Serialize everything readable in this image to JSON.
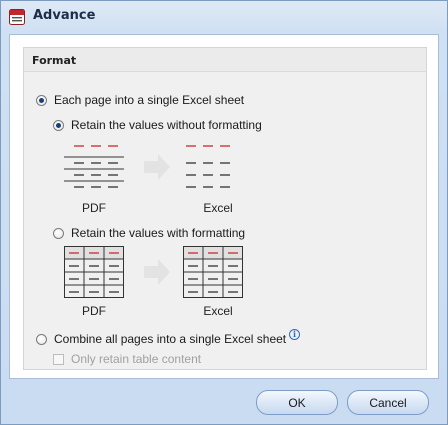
{
  "window": {
    "title": "Advance"
  },
  "format": {
    "heading": "Format",
    "option_each_page": {
      "label": "Each page into a single Excel sheet",
      "checked": true
    },
    "option_retain_values": {
      "label": "Retain the values without formatting",
      "checked": true
    },
    "diagram1": {
      "left_caption": "PDF",
      "right_caption": "Excel"
    },
    "option_retain_formatting": {
      "label": "Retain the values with formatting",
      "checked": false
    },
    "diagram2": {
      "left_caption": "PDF",
      "right_caption": "Excel"
    },
    "option_combine": {
      "label": "Combine all pages into a single Excel sheet",
      "checked": false
    },
    "option_table_only": {
      "label": "Only retain table content",
      "checked": false,
      "disabled": true
    }
  },
  "buttons": {
    "ok": "OK",
    "cancel": "Cancel"
  },
  "colors": {
    "title_bar": "#cfe0f3",
    "accent_red": "#cc2a2a",
    "line_dark": "#333333",
    "arrow_gray": "#e3e3e3"
  }
}
